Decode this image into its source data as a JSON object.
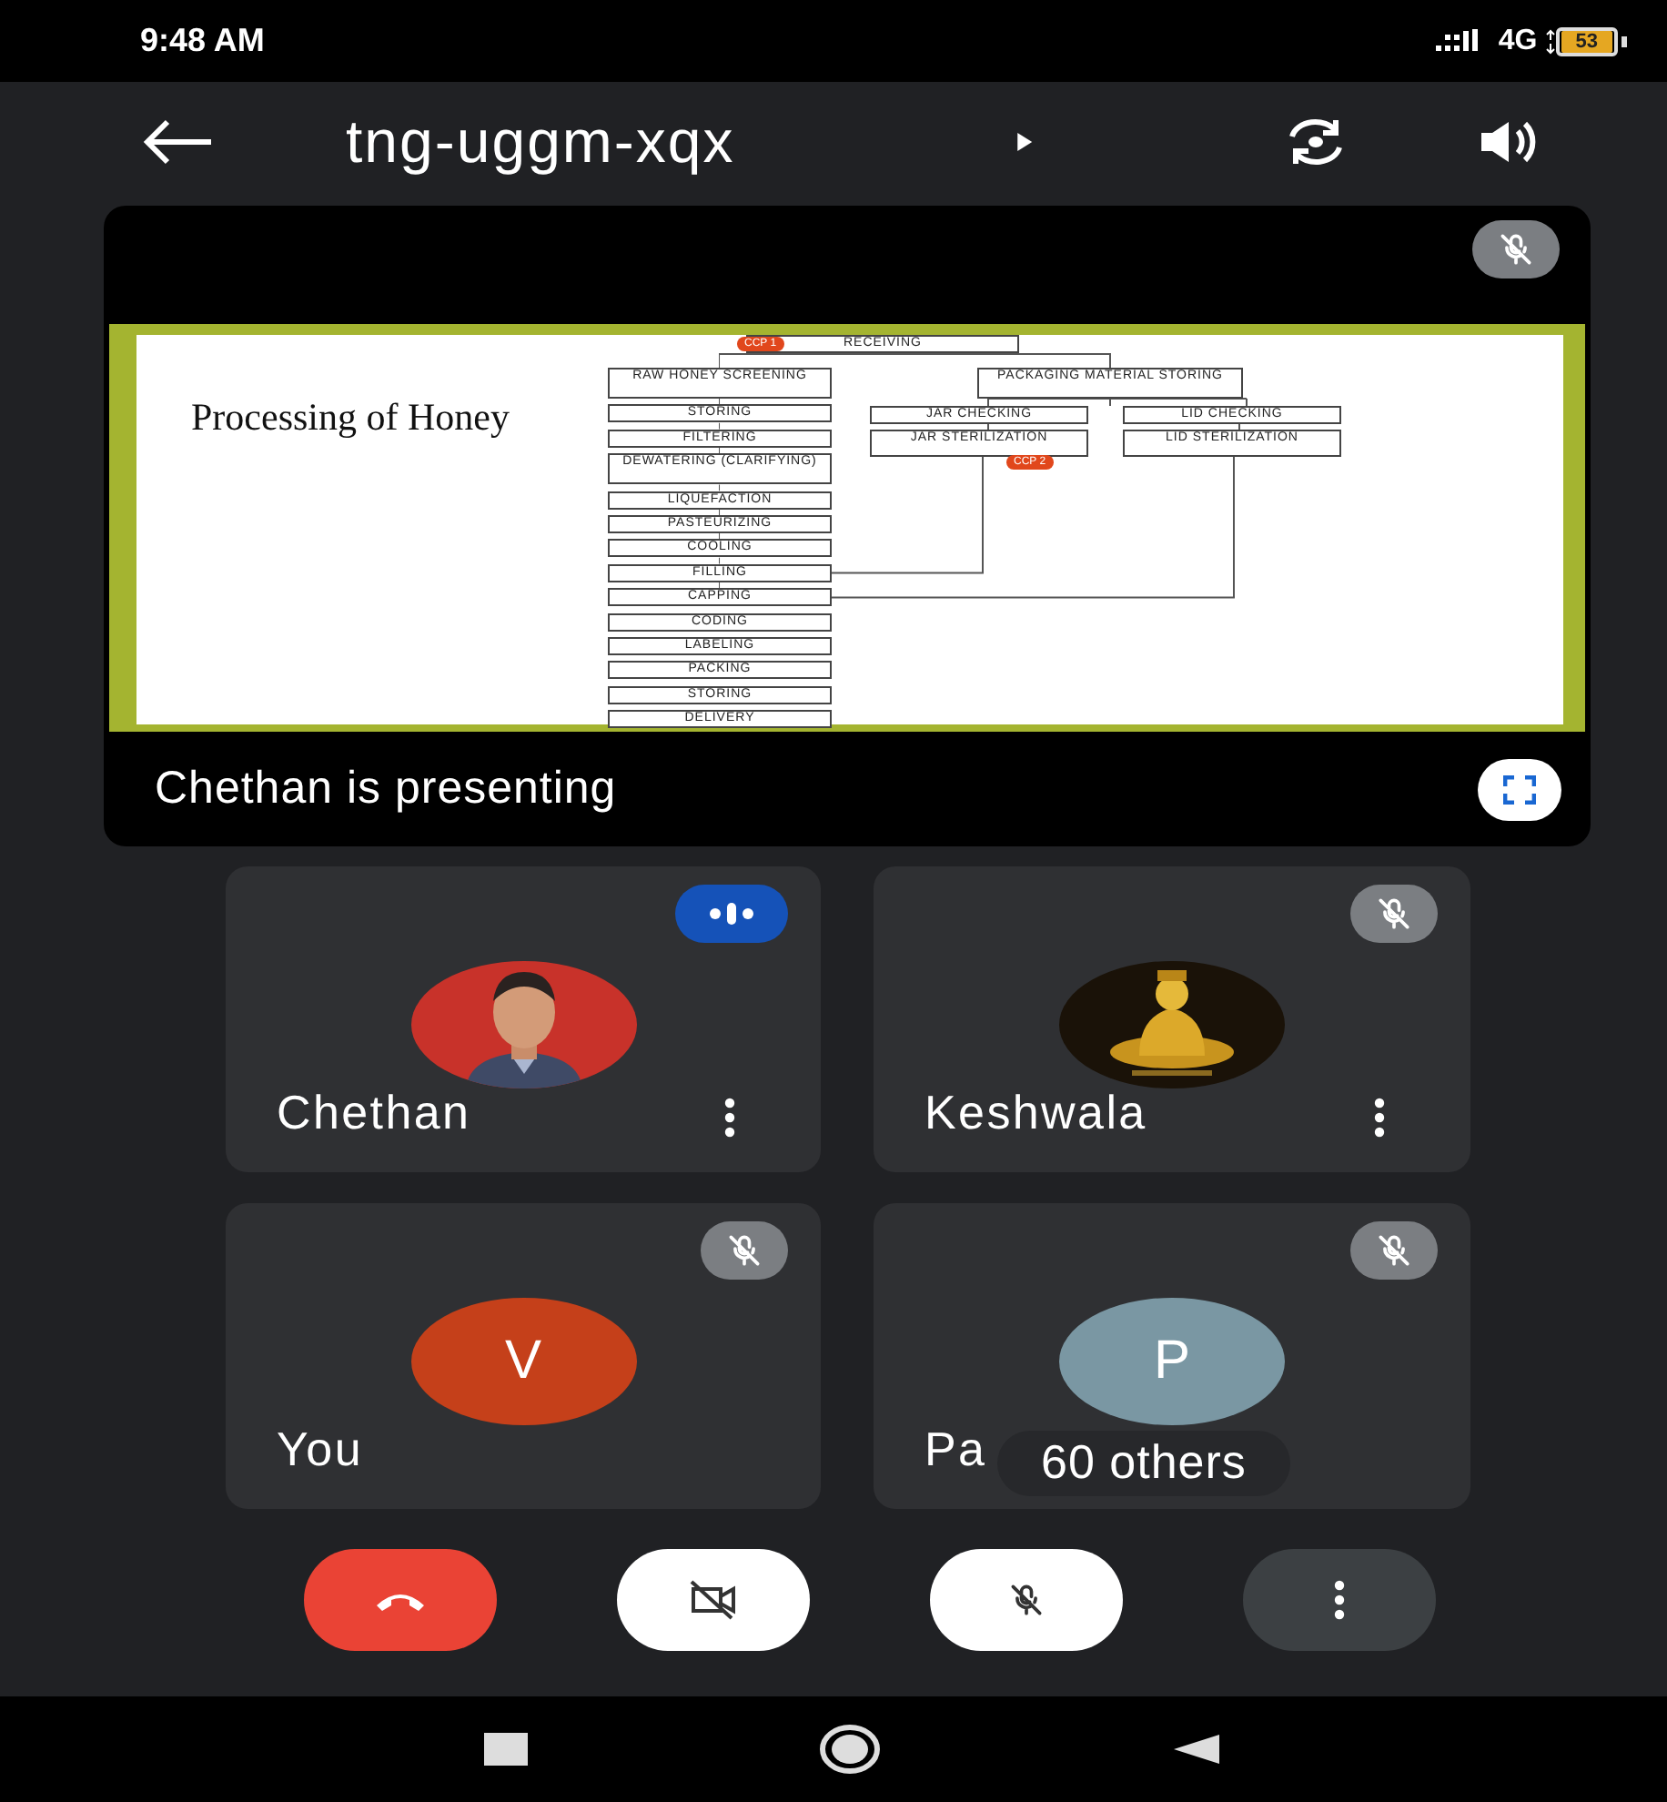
{
  "status_bar": {
    "time": "9:48 AM",
    "network": "4G",
    "battery": "53"
  },
  "header": {
    "meeting_code": "tng-uggm-xqx"
  },
  "presentation": {
    "presenter_muted": true,
    "caption": "Chethan is presenting",
    "slide": {
      "title": "Processing of Honey",
      "receiving": {
        "label": "RECEIVING",
        "ccp": "CCP 1"
      },
      "steps": [
        "RAW HONEY SCREENING",
        "STORING",
        "FILTERING",
        "DEWATERING (CLARIFYING)",
        "LIQUEFACTION",
        "PASTEURIZING",
        "COOLING",
        "FILLING",
        "CAPPING",
        "CODING",
        "LABELING",
        "PACKING",
        "STORING",
        "DELIVERY"
      ],
      "packaging": {
        "label": "PACKAGING MATERIAL STORING",
        "branches": [
          {
            "check": "JAR CHECKING",
            "sterilization": "JAR STERILIZATION",
            "ccp": "CCP 2"
          },
          {
            "check": "LID CHECKING",
            "sterilization": "LID STERILIZATION"
          }
        ]
      }
    }
  },
  "tiles": [
    {
      "name": "Chethan",
      "avatar": {
        "kind": "person",
        "color": "#c8322a"
      },
      "speaking": true,
      "muted": false,
      "menu": true
    },
    {
      "name": "Keshwala",
      "speaking": false,
      "muted": true,
      "menu": true
    },
    {
      "name": "You",
      "avatar": {
        "kind": "letter",
        "letter": "V",
        "color": "#c5401a"
      },
      "speaking": false,
      "muted": true,
      "menu": false
    },
    {
      "name": "Pa",
      "avatar": {
        "kind": "letter",
        "letter": "P",
        "color": "#7a97a3"
      },
      "speaking": false,
      "muted": true,
      "menu": false,
      "overflow": "60 others"
    }
  ],
  "controls": [
    {
      "kind": "end-call"
    },
    {
      "kind": "camera",
      "off": true
    },
    {
      "kind": "mic",
      "off": true
    },
    {
      "kind": "more"
    }
  ]
}
